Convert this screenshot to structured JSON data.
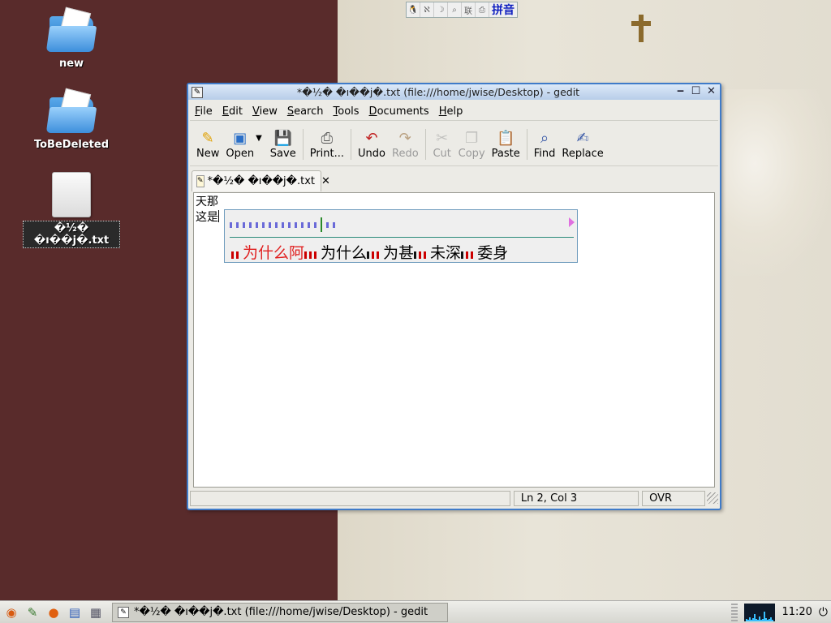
{
  "desktop": {
    "icons": [
      {
        "label": "new",
        "type": "folder-icon"
      },
      {
        "label": "ToBeDeleted",
        "type": "folder-icon"
      },
      {
        "label": "�½� �ı��j�.txt",
        "type": "document-icon"
      }
    ]
  },
  "ime_status": {
    "segments": [
      "🐧",
      "ℵ",
      "☽",
      "⌕",
      "联",
      "⎙"
    ],
    "mode_label": "拼音"
  },
  "window": {
    "title": "*�½� �ı��j�.txt (file:///home/jwise/Desktop) - gedit",
    "menus": [
      {
        "label": "File",
        "mnemonic": "F",
        "rest": "ile"
      },
      {
        "label": "Edit",
        "mnemonic": "E",
        "rest": "dit"
      },
      {
        "label": "View",
        "mnemonic": "V",
        "rest": "iew"
      },
      {
        "label": "Search",
        "mnemonic": "S",
        "rest": "earch"
      },
      {
        "label": "Tools",
        "mnemonic": "T",
        "rest": "ools"
      },
      {
        "label": "Documents",
        "mnemonic": "D",
        "rest": "ocuments"
      },
      {
        "label": "Help",
        "mnemonic": "H",
        "rest": "elp"
      }
    ],
    "toolbar": {
      "new": "New",
      "open": "Open",
      "save": "Save",
      "print": "Print...",
      "undo": "Undo",
      "redo": "Redo",
      "cut": "Cut",
      "copy": "Copy",
      "paste": "Paste",
      "find": "Find",
      "replace": "Replace"
    },
    "tab": {
      "label": "*�½� �ı��j�.txt",
      "close": "✕"
    },
    "editor_lines": [
      "天那",
      "这是"
    ],
    "status": {
      "position": "Ln 2, Col 3",
      "mode": "OVR"
    }
  },
  "ime_popup": {
    "preedit_count": 16,
    "candidates": [
      {
        "text": "为什么阿",
        "marks": [
          "r",
          "r"
        ]
      },
      {
        "text": "为什么",
        "marks": [
          "r",
          "r",
          "r"
        ]
      },
      {
        "text": "为甚",
        "marks": [
          "k",
          "r",
          "r"
        ]
      },
      {
        "text": "未深",
        "marks": [
          "k",
          "r",
          "r"
        ]
      },
      {
        "text": "委身",
        "marks": [
          "k",
          "r",
          "r"
        ]
      }
    ]
  },
  "taskbar": {
    "task_label": "*�½� �ı��j�.txt (file:///home/jwise/Desktop) - gedit",
    "clock": "11:20"
  }
}
